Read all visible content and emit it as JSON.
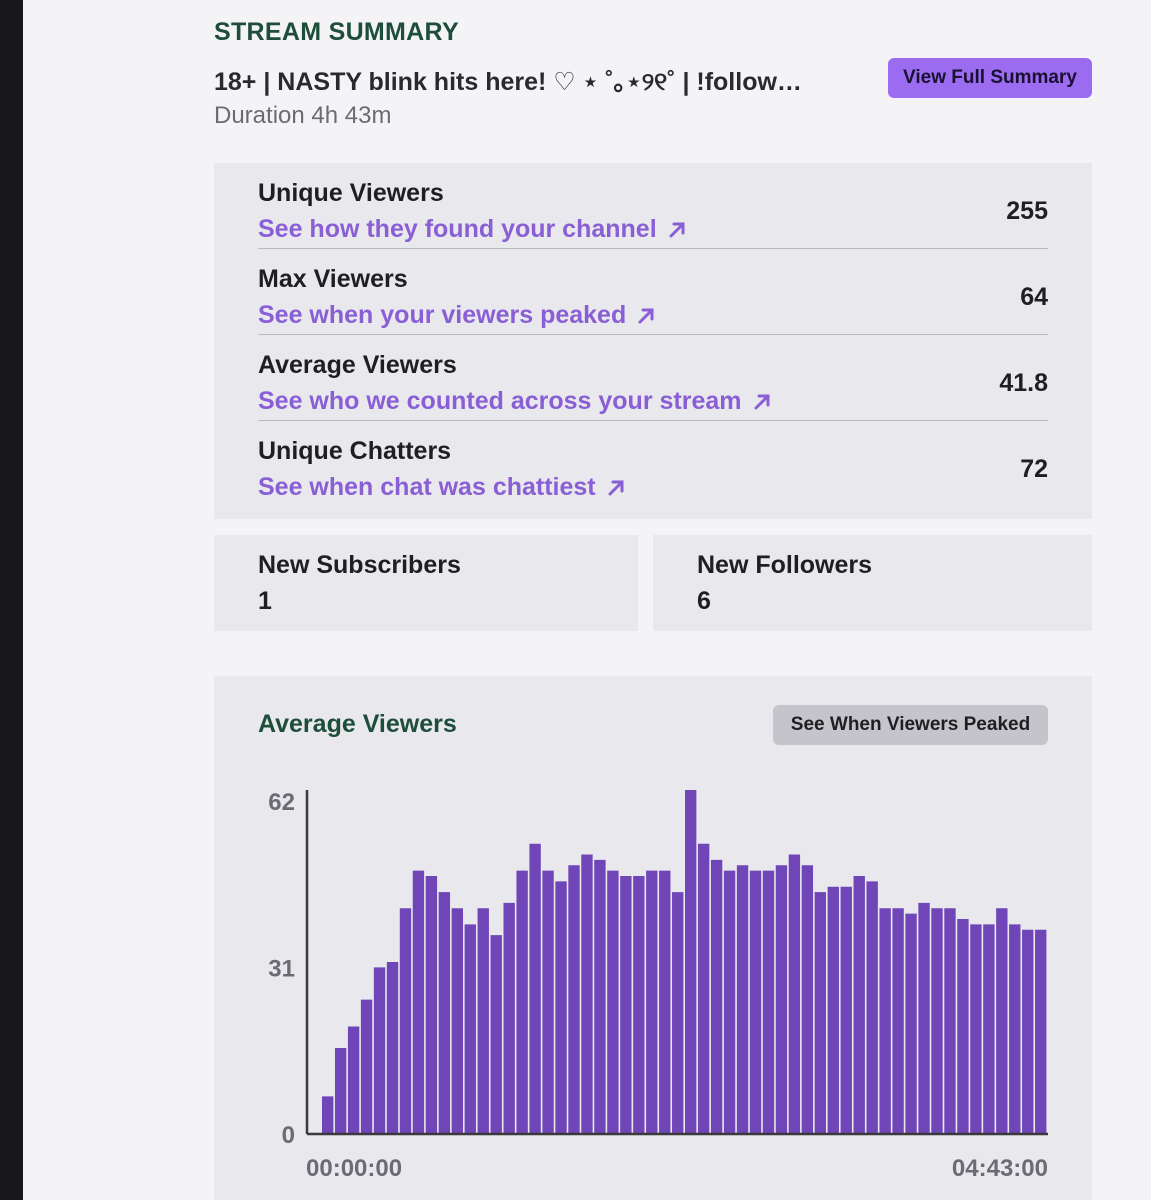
{
  "header": {
    "section_label": "STREAM SUMMARY",
    "stream_title": "18+ | NASTY blink hits here! ♡ ⋆ ˚｡⋆୨୧˚ | !follow…",
    "duration": "Duration 4h 43m",
    "view_full_label": "View Full Summary"
  },
  "stats": [
    {
      "label": "Unique Viewers",
      "link": "See how they found your channel",
      "value": "255"
    },
    {
      "label": "Max Viewers",
      "link": "See when your viewers peaked",
      "value": "64"
    },
    {
      "label": "Average Viewers",
      "link": "See who we counted across your stream",
      "value": "41.8"
    },
    {
      "label": "Unique Chatters",
      "link": "See when chat was chattiest",
      "value": "72"
    }
  ],
  "mini_stats": [
    {
      "label": "New Subscribers",
      "value": "1"
    },
    {
      "label": "New Followers",
      "value": "6"
    }
  ],
  "chart_card": {
    "title": "Average Viewers",
    "button_label": "See When Viewers Peaked"
  },
  "colors": {
    "accent": "#9b6cf0",
    "link": "#8a5fd6",
    "bar": "#6f45b8",
    "heading_green": "#1e4d3a"
  },
  "chart_data": {
    "type": "bar",
    "title": "Average Viewers",
    "x_start_label": "00:00:00",
    "x_end_label": "04:43:00",
    "yticks": [
      0,
      31,
      62
    ],
    "ylim": [
      0,
      64
    ],
    "values": [
      7,
      16,
      20,
      25,
      31,
      32,
      42,
      49,
      48,
      45,
      42,
      39,
      42,
      37,
      43,
      49,
      54,
      49,
      47,
      50,
      52,
      51,
      49,
      48,
      48,
      49,
      49,
      45,
      64,
      54,
      51,
      49,
      50,
      49,
      49,
      50,
      52,
      50,
      45,
      46,
      46,
      48,
      47,
      42,
      42,
      41,
      43,
      42,
      42,
      40,
      39,
      39,
      42,
      39,
      38,
      38
    ]
  }
}
